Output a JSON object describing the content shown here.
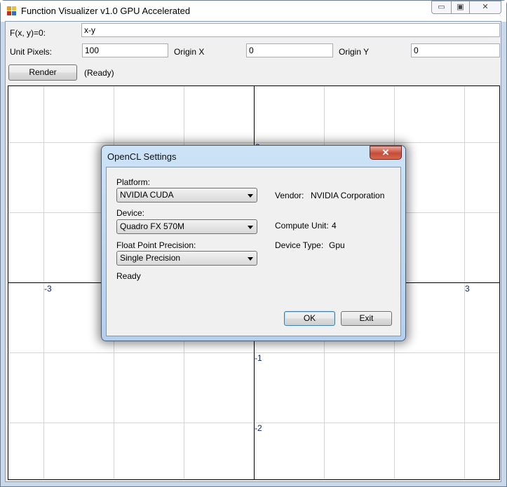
{
  "window": {
    "title": "Function Visualizer v1.0 GPU Accelerated",
    "controls": {
      "minimize": "▭",
      "maximize": "▣",
      "close": "✕"
    }
  },
  "form": {
    "function_label": "F(x, y)=0:",
    "function_value": "x-y",
    "unit_pixels_label": "Unit Pixels:",
    "unit_pixels_value": "100",
    "origin_x_label": "Origin X",
    "origin_x_value": "0",
    "origin_y_label": "Origin Y",
    "origin_y_value": "0",
    "render_label": "Render",
    "status": "(Ready)"
  },
  "plot": {
    "x_tick_labels": [
      "-3",
      "3"
    ],
    "y_tick_labels": [
      "2",
      "-1",
      "-2"
    ]
  },
  "dialog": {
    "title": "OpenCL Settings",
    "close": "✕",
    "platform_label": "Platform:",
    "platform_value": "NVIDIA CUDA",
    "device_label": "Device:",
    "device_value": "Quadro FX 570M",
    "precision_label": "Float Point Precision:",
    "precision_value": "Single Precision",
    "status": "Ready",
    "vendor_label": "Vendor:",
    "vendor_value": "NVIDIA Corporation",
    "compute_unit_label": "Compute Unit:",
    "compute_unit_value": "4",
    "device_type_label": "Device Type:",
    "device_type_value": "Gpu",
    "ok_label": "OK",
    "exit_label": "Exit"
  }
}
